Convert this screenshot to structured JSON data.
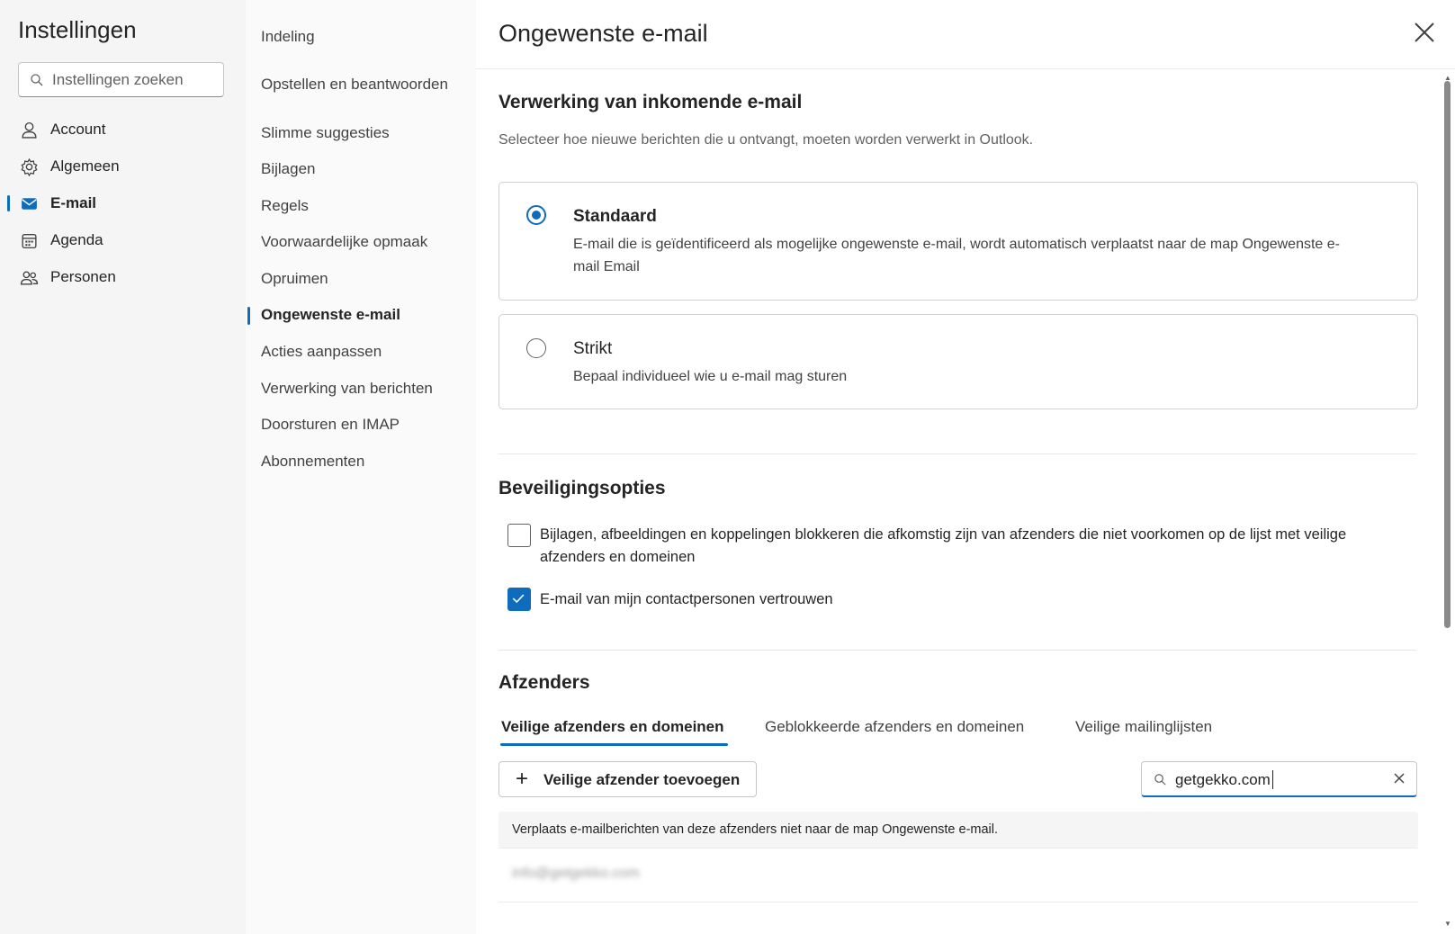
{
  "settings": {
    "title": "Instellingen",
    "search_placeholder": "Instellingen zoeken",
    "categories": [
      {
        "label": "Account",
        "icon": "person-icon"
      },
      {
        "label": "Algemeen",
        "icon": "gear-icon"
      },
      {
        "label": "E-mail",
        "icon": "mail-icon",
        "selected": true
      },
      {
        "label": "Agenda",
        "icon": "calendar-icon"
      },
      {
        "label": "Personen",
        "icon": "people-icon"
      }
    ]
  },
  "mail_nav": {
    "items": [
      {
        "label": "Indeling"
      },
      {
        "label": "Opstellen en beantwoorden"
      },
      {
        "label": "Slimme suggesties"
      },
      {
        "label": "Bijlagen"
      },
      {
        "label": "Regels"
      },
      {
        "label": "Voorwaardelijke opmaak"
      },
      {
        "label": "Opruimen"
      },
      {
        "label": "Ongewenste e-mail",
        "selected": true
      },
      {
        "label": "Acties aanpassen"
      },
      {
        "label": "Verwerking van berichten"
      },
      {
        "label": "Doorsturen en IMAP"
      },
      {
        "label": "Abonnementen"
      }
    ]
  },
  "main": {
    "title": "Ongewenste e-mail",
    "incoming": {
      "title": "Verwerking van inkomende e-mail",
      "description": "Selecteer hoe nieuwe berichten die u ontvangt, moeten worden verwerkt in Outlook.",
      "options": [
        {
          "title": "Standaard",
          "description": "E-mail die is geïdentificeerd als mogelijke ongewenste e-mail, wordt automatisch verplaatst naar de map Ongewenste e-mail Email",
          "selected": true
        },
        {
          "title": "Strikt",
          "description": "Bepaal individueel wie u e-mail mag sturen",
          "selected": false
        }
      ]
    },
    "security": {
      "title": "Beveiligingsopties",
      "options": [
        {
          "label": "Bijlagen, afbeeldingen en koppelingen blokkeren die afkomstig zijn van afzenders die niet voorkomen op de lijst met veilige afzenders en domeinen",
          "checked": false
        },
        {
          "label": "E-mail van mijn contactpersonen vertrouwen",
          "checked": true
        }
      ]
    },
    "senders": {
      "title": "Afzenders",
      "tabs": [
        {
          "label": "Veilige afzenders en domeinen",
          "selected": true
        },
        {
          "label": "Geblokkeerde afzenders en domeinen"
        },
        {
          "label": "Veilige mailinglijsten"
        }
      ],
      "add_button": "Veilige afzender toevoegen",
      "filter_value": "getgekko.com",
      "info": "Verplaats e-mailberichten van deze afzenders niet naar de map Ongewenste e-mail.",
      "entries": [
        "info@getgekko.com"
      ]
    }
  },
  "colors": {
    "accent": "#0f6cbd",
    "nav_bg": "#f5f5f5"
  }
}
